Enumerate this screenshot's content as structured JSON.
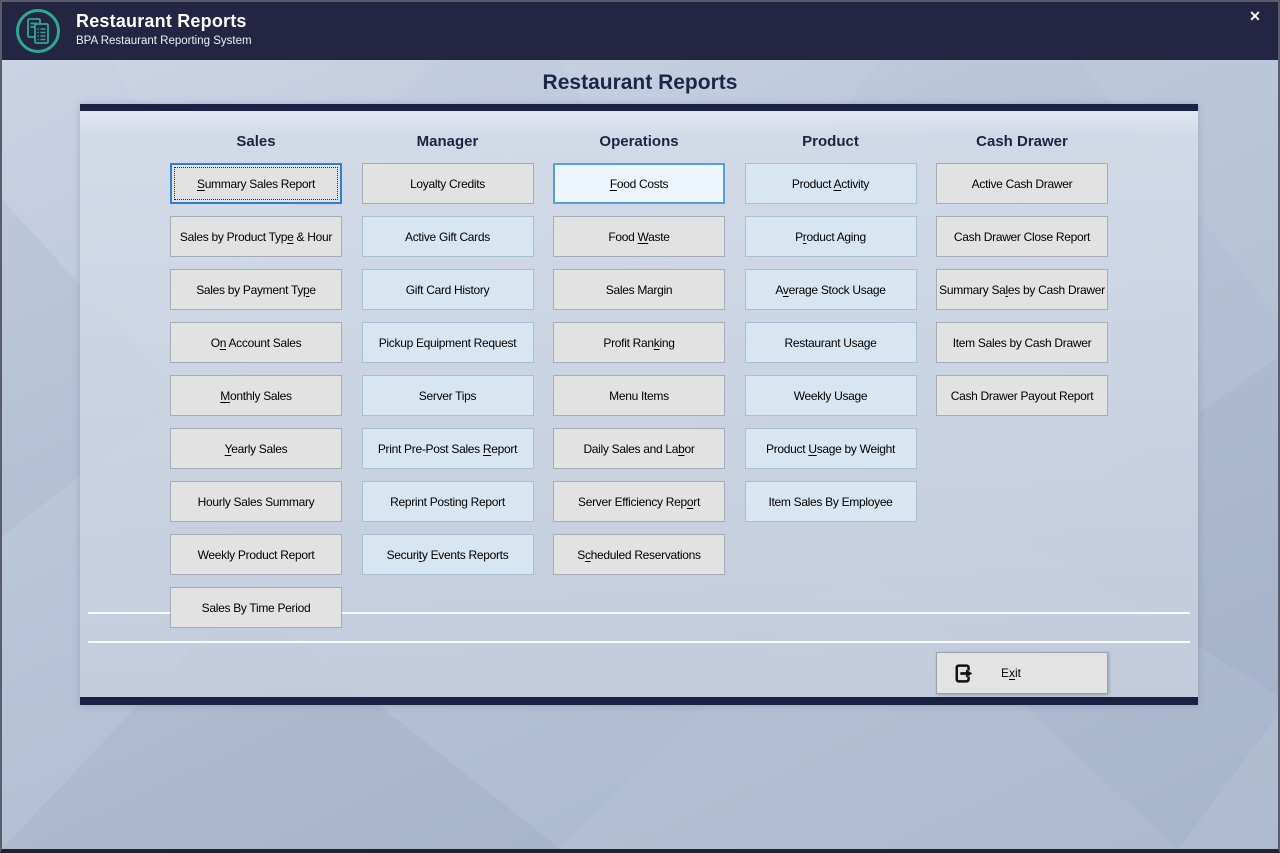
{
  "titlebar": {
    "title": "Restaurant Reports",
    "subtitle": "BPA Restaurant Reporting System",
    "close_glyph": "✕"
  },
  "page": {
    "title": "Restaurant Reports"
  },
  "colors": {
    "titlebar_bg": "#232542",
    "logo_teal": "#2EA893",
    "accent_navy": "#1B2142",
    "button_grey": "#E2E2E2",
    "button_grey_border": "#A6ADB8",
    "button_blue": "#D8E6F2",
    "button_blue_border": "#A9BFD3",
    "focus_border": "#2E7FD3",
    "highlight_bg": "#EDF6FD",
    "highlight_border": "#55A0DC"
  },
  "columns": [
    {
      "header": "Sales",
      "buttons": [
        {
          "label": "Summary Sales Report",
          "accesskey_index": 0,
          "variant": "focused"
        },
        {
          "label": "Sales by Product Type & Hour",
          "accesskey_index": 20,
          "variant": "grey"
        },
        {
          "label": "Sales by Payment Type",
          "accesskey_index": 19,
          "variant": "grey"
        },
        {
          "label": "On Account Sales",
          "accesskey_index": 1,
          "variant": "grey"
        },
        {
          "label": "Monthly Sales",
          "accesskey_index": 0,
          "variant": "grey"
        },
        {
          "label": "Yearly Sales",
          "accesskey_index": 0,
          "variant": "grey"
        },
        {
          "label": "Hourly Sales Summary",
          "accesskey_index": -1,
          "variant": "grey"
        },
        {
          "label": "Weekly Product Report",
          "accesskey_index": -1,
          "variant": "grey"
        },
        {
          "label": "Sales By Time Period",
          "accesskey_index": -1,
          "variant": "grey"
        }
      ]
    },
    {
      "header": "Manager",
      "buttons": [
        {
          "label": "Loyalty Credits",
          "accesskey_index": -1,
          "variant": "grey"
        },
        {
          "label": "Active Gift Cards",
          "accesskey_index": -1,
          "variant": "blue"
        },
        {
          "label": "Gift Card History",
          "accesskey_index": -1,
          "variant": "blue"
        },
        {
          "label": "Pickup Equipment Request",
          "accesskey_index": -1,
          "variant": "blue"
        },
        {
          "label": "Server Tips",
          "accesskey_index": -1,
          "variant": "blue"
        },
        {
          "label": "Print Pre-Post Sales Report",
          "accesskey_index": 21,
          "variant": "blue"
        },
        {
          "label": "Reprint Posting Report",
          "accesskey_index": -1,
          "variant": "blue"
        },
        {
          "label": "Security Events Reports",
          "accesskey_index": 6,
          "variant": "blue"
        }
      ]
    },
    {
      "header": "Operations",
      "buttons": [
        {
          "label": "Food Costs",
          "accesskey_index": 0,
          "variant": "highlight"
        },
        {
          "label": "Food Waste",
          "accesskey_index": 5,
          "variant": "grey"
        },
        {
          "label": "Sales Margin",
          "accesskey_index": -1,
          "variant": "grey"
        },
        {
          "label": "Profit Ranking",
          "accesskey_index": 10,
          "variant": "grey"
        },
        {
          "label": "Menu Items",
          "accesskey_index": -1,
          "variant": "grey"
        },
        {
          "label": "Daily Sales and Labor",
          "accesskey_index": 18,
          "variant": "grey"
        },
        {
          "label": "Server Efficiency Report",
          "accesskey_index": 21,
          "variant": "grey"
        },
        {
          "label": "Scheduled Reservations",
          "accesskey_index": 1,
          "variant": "grey"
        }
      ]
    },
    {
      "header": "Product",
      "buttons": [
        {
          "label": "Product Activity",
          "accesskey_index": 8,
          "variant": "blue"
        },
        {
          "label": "Product Aging",
          "accesskey_index": 1,
          "variant": "blue"
        },
        {
          "label": "Average Stock Usage",
          "accesskey_index": 1,
          "variant": "blue"
        },
        {
          "label": "Restaurant Usage",
          "accesskey_index": -1,
          "variant": "blue"
        },
        {
          "label": "Weekly Usage",
          "accesskey_index": -1,
          "variant": "blue"
        },
        {
          "label": "Product Usage by Weight",
          "accesskey_index": 8,
          "variant": "blue"
        },
        {
          "label": "Item Sales By Employee",
          "accesskey_index": -1,
          "variant": "blue"
        }
      ]
    },
    {
      "header": "Cash Drawer",
      "buttons": [
        {
          "label": "Active Cash Drawer",
          "accesskey_index": -1,
          "variant": "grey"
        },
        {
          "label": "Cash Drawer Close Report",
          "accesskey_index": -1,
          "variant": "grey"
        },
        {
          "label": "Summary Sales by Cash Drawer",
          "accesskey_index": 10,
          "variant": "grey"
        },
        {
          "label": "Item Sales by Cash Drawer",
          "accesskey_index": -1,
          "variant": "grey"
        },
        {
          "label": "Cash Drawer Payout Report",
          "accesskey_index": -1,
          "variant": "grey"
        }
      ]
    }
  ],
  "footer": {
    "exit_label": "Exit",
    "exit_accesskey_index": 1
  }
}
